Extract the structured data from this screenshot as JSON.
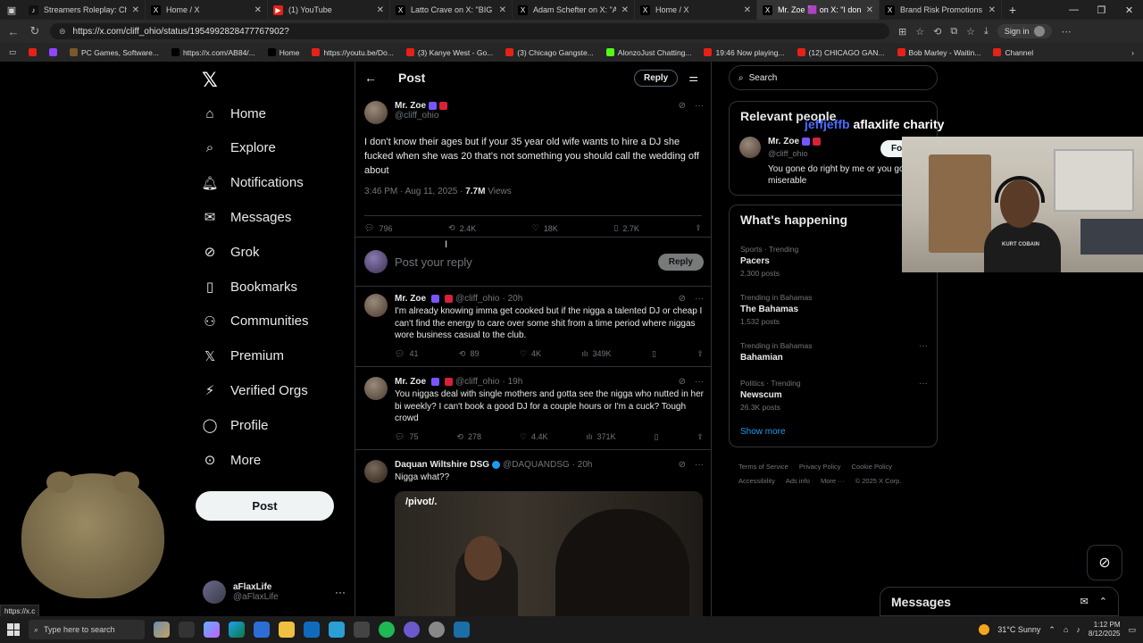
{
  "browser": {
    "tabs": [
      {
        "title": "Streamers Roleplay: Chat C",
        "fav": "#111",
        "favglyph": "♪"
      },
      {
        "title": "Home / X",
        "fav": "#000",
        "favglyph": "X"
      },
      {
        "title": "(1) YouTube",
        "fav": "#e62117",
        "favglyph": "▶"
      },
      {
        "title": "Latto Crave on X: \"BIG LATT",
        "fav": "#000",
        "favglyph": "X"
      },
      {
        "title": "Adam Schefter on X: \"After",
        "fav": "#000",
        "favglyph": "X"
      },
      {
        "title": "Home / X",
        "fav": "#000",
        "favglyph": "X"
      },
      {
        "title": "Mr. Zoe 🟪 on X: \"I don",
        "fav": "#000",
        "favglyph": "X"
      },
      {
        "title": "Brand Risk Promotions on",
        "fav": "#000",
        "favglyph": "X"
      }
    ],
    "url": "https://x.com/cliff_ohio/status/1954992828477767902?",
    "signin": "Sign in",
    "bookmarks": [
      {
        "label": "",
        "color": "#e62117"
      },
      {
        "label": "",
        "color": "#9146ff"
      },
      {
        "label": "PC Games, Software...",
        "color": "#7a5a2a"
      },
      {
        "label": "https://x.com/AB84/...",
        "color": "#000"
      },
      {
        "label": "Home",
        "color": "#000"
      },
      {
        "label": "https://youtu.be/Do...",
        "color": "#e62117"
      },
      {
        "label": "(3) Kanye West - Go...",
        "color": "#e62117"
      },
      {
        "label": "(3) Chicago Gangste...",
        "color": "#e62117"
      },
      {
        "label": "AlonzoJust Chatting...",
        "color": "#53fc18"
      },
      {
        "label": "19:46 Now playing...",
        "color": "#e62117"
      },
      {
        "label": "(12) CHICAGO GAN...",
        "color": "#e62117"
      },
      {
        "label": "Bob Marley - Waitin...",
        "color": "#e62117"
      },
      {
        "label": "Channel",
        "color": "#e62117"
      }
    ]
  },
  "nav": {
    "items": [
      "Home",
      "Explore",
      "Notifications",
      "Messages",
      "Grok",
      "Bookmarks",
      "Communities",
      "Premium",
      "Verified Orgs",
      "Profile",
      "More"
    ],
    "post_label": "Post",
    "account": {
      "name": "aFlaxLife",
      "handle": "@aFlaxLife"
    }
  },
  "header": {
    "title": "Post",
    "reply_label": "Reply"
  },
  "main_post": {
    "name": "Mr. Zoe",
    "handle": "@cliff_ohio",
    "text": "I don't know their ages but if your 35 year old wife wants to hire a DJ she fucked when she was 20 that's not something you should call the wedding off about",
    "time": "3:46 PM · Aug 11, 2025 · ",
    "views": "7.7M",
    "views_label": " Views",
    "replies": "796",
    "reposts": "2.4K",
    "likes": "18K",
    "bookmarks": "2.7K"
  },
  "reply_box": {
    "placeholder": "Post your reply",
    "button": "Reply"
  },
  "replies": [
    {
      "name": "Mr. Zoe",
      "handle": "@cliff_ohio",
      "age": "· 20h",
      "text": "I'm already knowing imma get cooked but if the nigga a talented DJ or cheap I can't find the energy to care over some shit from a time period where niggas wore business casual to the club.",
      "replies": "41",
      "reposts": "89",
      "likes": "4K",
      "views": "349K"
    },
    {
      "name": "Mr. Zoe",
      "handle": "@cliff_ohio",
      "age": "· 19h",
      "text": "You niggas deal with single mothers and gotta see the nigga who nutted in her bi weekly? I can't book a good DJ for a couple hours or I'm a cuck? Tough crowd",
      "replies": "75",
      "reposts": "278",
      "likes": "4.4K",
      "views": "371K"
    },
    {
      "name": "Daquan Wiltshire DSG",
      "handle": "@DAQUANDSG",
      "age": "· 20h",
      "text": "Nigga what??",
      "media_label": "/pivot/."
    }
  ],
  "right": {
    "search_placeholder": "Search",
    "relevant_title": "Relevant people",
    "overlay_a": "jeffjeffb",
    "overlay_b": "aflaxlife charity",
    "person": {
      "name": "Mr. Zoe",
      "handle": "@cliff_ohio",
      "follow": "Follow",
      "bio": "You gone do right by me or you gone be miserable"
    },
    "happening_title": "What's happening",
    "trends": [
      {
        "context": "Sports · Trending",
        "name": "Pacers",
        "count": "2,300 posts"
      },
      {
        "context": "Trending in Bahamas",
        "name": "The Bahamas",
        "count": "1,532 posts"
      },
      {
        "context": "Trending in Bahamas",
        "name": "Bahamian",
        "count": ""
      },
      {
        "context": "Politics · Trending",
        "name": "Newscum",
        "count": "26.3K posts"
      }
    ],
    "show_more": "Show more",
    "footer": [
      "Terms of Service",
      "Privacy Policy",
      "Cookie Policy",
      "Accessibility",
      "Ads info",
      "More ···",
      "© 2025 X Corp."
    ]
  },
  "webcam": {
    "shirt_text": "KURT COBAIN"
  },
  "messages_label": "Messages",
  "status_url": "https://x.c",
  "taskbar": {
    "search_placeholder": "Type here to search",
    "weather": "31°C  Sunny",
    "time": "1:12 PM",
    "date": "8/12/2025"
  }
}
